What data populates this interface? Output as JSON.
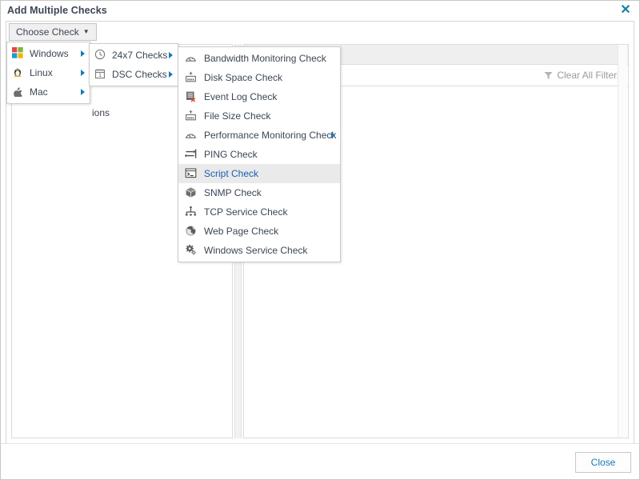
{
  "window": {
    "title": "Add Multiple Checks",
    "close_icon": "close-x-icon"
  },
  "toolbar": {
    "choose_check_label": "Choose Check",
    "caret_glyph": "▼"
  },
  "left_panel": {
    "partial_label": "ions"
  },
  "right_panel": {
    "clear_filters_label": "Clear All Filters",
    "filter_icon": "funnel-icon"
  },
  "footer": {
    "close_label": "Close"
  },
  "menus": {
    "level1": [
      {
        "label": "Windows",
        "icon": "windows-logo-icon",
        "has_submenu": true,
        "selected": false
      },
      {
        "label": "Linux",
        "icon": "linux-penguin-icon",
        "has_submenu": true,
        "selected": false
      },
      {
        "label": "Mac",
        "icon": "apple-logo-icon",
        "has_submenu": true,
        "selected": false
      }
    ],
    "level2": [
      {
        "label": "24x7 Checks",
        "icon": "clock-icon",
        "has_submenu": true,
        "selected": false
      },
      {
        "label": "DSC Checks",
        "icon": "calendar-icon",
        "has_submenu": true,
        "selected": false
      }
    ],
    "level3": [
      {
        "label": "Bandwidth Monitoring Check",
        "icon": "gauge-icon",
        "has_submenu": false,
        "selected": false
      },
      {
        "label": "Disk Space Check",
        "icon": "disk-plus-icon",
        "has_submenu": false,
        "selected": false
      },
      {
        "label": "Event Log Check",
        "icon": "event-log-icon",
        "has_submenu": false,
        "selected": false
      },
      {
        "label": "File Size Check",
        "icon": "file-size-icon",
        "has_submenu": false,
        "selected": false
      },
      {
        "label": "Performance Monitoring Check",
        "icon": "gauge-icon",
        "has_submenu": true,
        "selected": false
      },
      {
        "label": "PING Check",
        "icon": "ping-arrows-icon",
        "has_submenu": false,
        "selected": false
      },
      {
        "label": "Script Check",
        "icon": "console-icon",
        "has_submenu": false,
        "selected": true
      },
      {
        "label": "SNMP Check",
        "icon": "box-icon",
        "has_submenu": false,
        "selected": false
      },
      {
        "label": "TCP Service Check",
        "icon": "network-node-icon",
        "has_submenu": false,
        "selected": false
      },
      {
        "label": "Web Page Check",
        "icon": "globe-icon",
        "has_submenu": false,
        "selected": false
      },
      {
        "label": "Windows Service Check",
        "icon": "gears-icon",
        "has_submenu": false,
        "selected": false
      }
    ]
  },
  "colors": {
    "accent_blue": "#1879b7",
    "title_text": "#3c4654",
    "selected_text": "#1a5fb4",
    "selected_bg": "#eaeaea",
    "muted_text": "#9a9a9a",
    "panel_border": "#dcdcdc"
  }
}
